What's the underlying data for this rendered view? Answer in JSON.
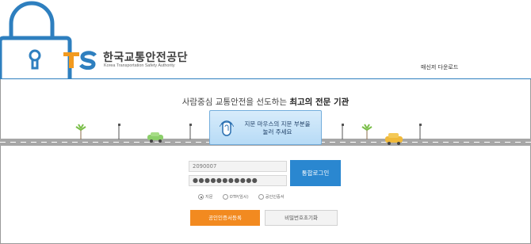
{
  "header": {
    "logo_mark": "TS",
    "logo_korean": "한국교통안전공단",
    "logo_english": "Korea Transportation Safety Authority",
    "download_link": "매신저 다운로드"
  },
  "slogan": {
    "prefix": "사람중심 교통안전을 선도하는 ",
    "highlight": "최고의 전문 기관"
  },
  "fingerprint": {
    "line1": "지문 마우스의 지문 부분을",
    "line2": "눌러 주세요"
  },
  "login": {
    "id_value": "2090007",
    "password_value": "●●●●●●●●●●●",
    "login_button": "통합로그인",
    "auth_options": [
      {
        "label": "지문",
        "selected": true
      },
      {
        "label": "OTP(임시)",
        "selected": false
      },
      {
        "label": "공인인증서",
        "selected": false
      }
    ],
    "cert_register_button": "공인인증서등록",
    "password_reset_button": "비밀번호초기화"
  },
  "colors": {
    "accent_blue": "#2a87d0",
    "accent_orange": "#f28a20",
    "lock_blue": "#2e7fbf"
  }
}
